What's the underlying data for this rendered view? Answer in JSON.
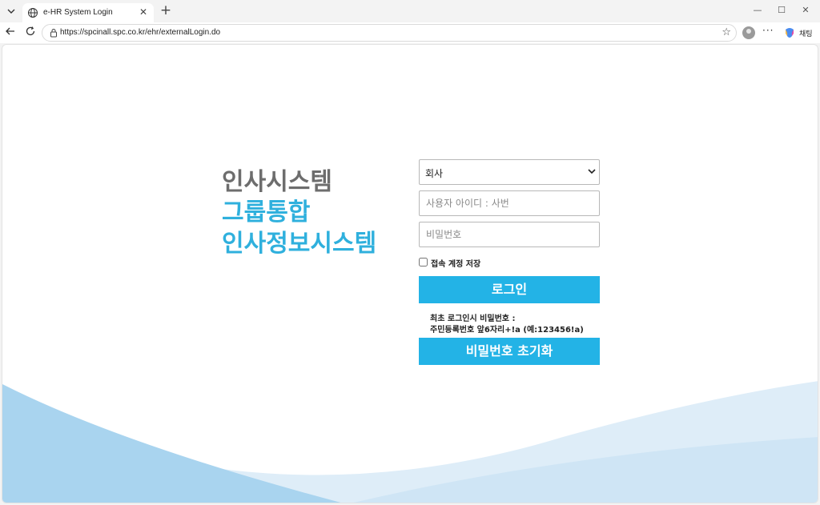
{
  "browser": {
    "tab_title": "e-HR System Login",
    "url": "https://spcinall.spc.co.kr/ehr/externalLogin.do",
    "copilot_label": "채팅",
    "new_tab_label": "+",
    "close_tab_label": "✕",
    "more_label": "···",
    "minimize_label": "—",
    "maximize_label": "☐",
    "close_window_label": "✕"
  },
  "headline": {
    "line1": "인사시스템",
    "line2": "그룹통합",
    "line3": "인사정보시스템"
  },
  "form": {
    "company_select_value": "회사",
    "user_id_placeholder": "사용자 아이디 : 사번",
    "password_placeholder": "비밀번호",
    "remember_label": "접속 계정 저장",
    "login_label": "로그인",
    "hint_line1": "최초 로그인시 비밀번호 :",
    "hint_line2": "주민등록번호 앞6자리+!a (예:123456!a)",
    "reset_label": "비밀번호 초기화"
  },
  "colors": {
    "accent": "#23b3e6",
    "headline_blue": "#2fb0dd",
    "headline_gray": "#6d6d6d",
    "wave_light": "#deedf8",
    "wave_dark": "#a9d4ef"
  }
}
